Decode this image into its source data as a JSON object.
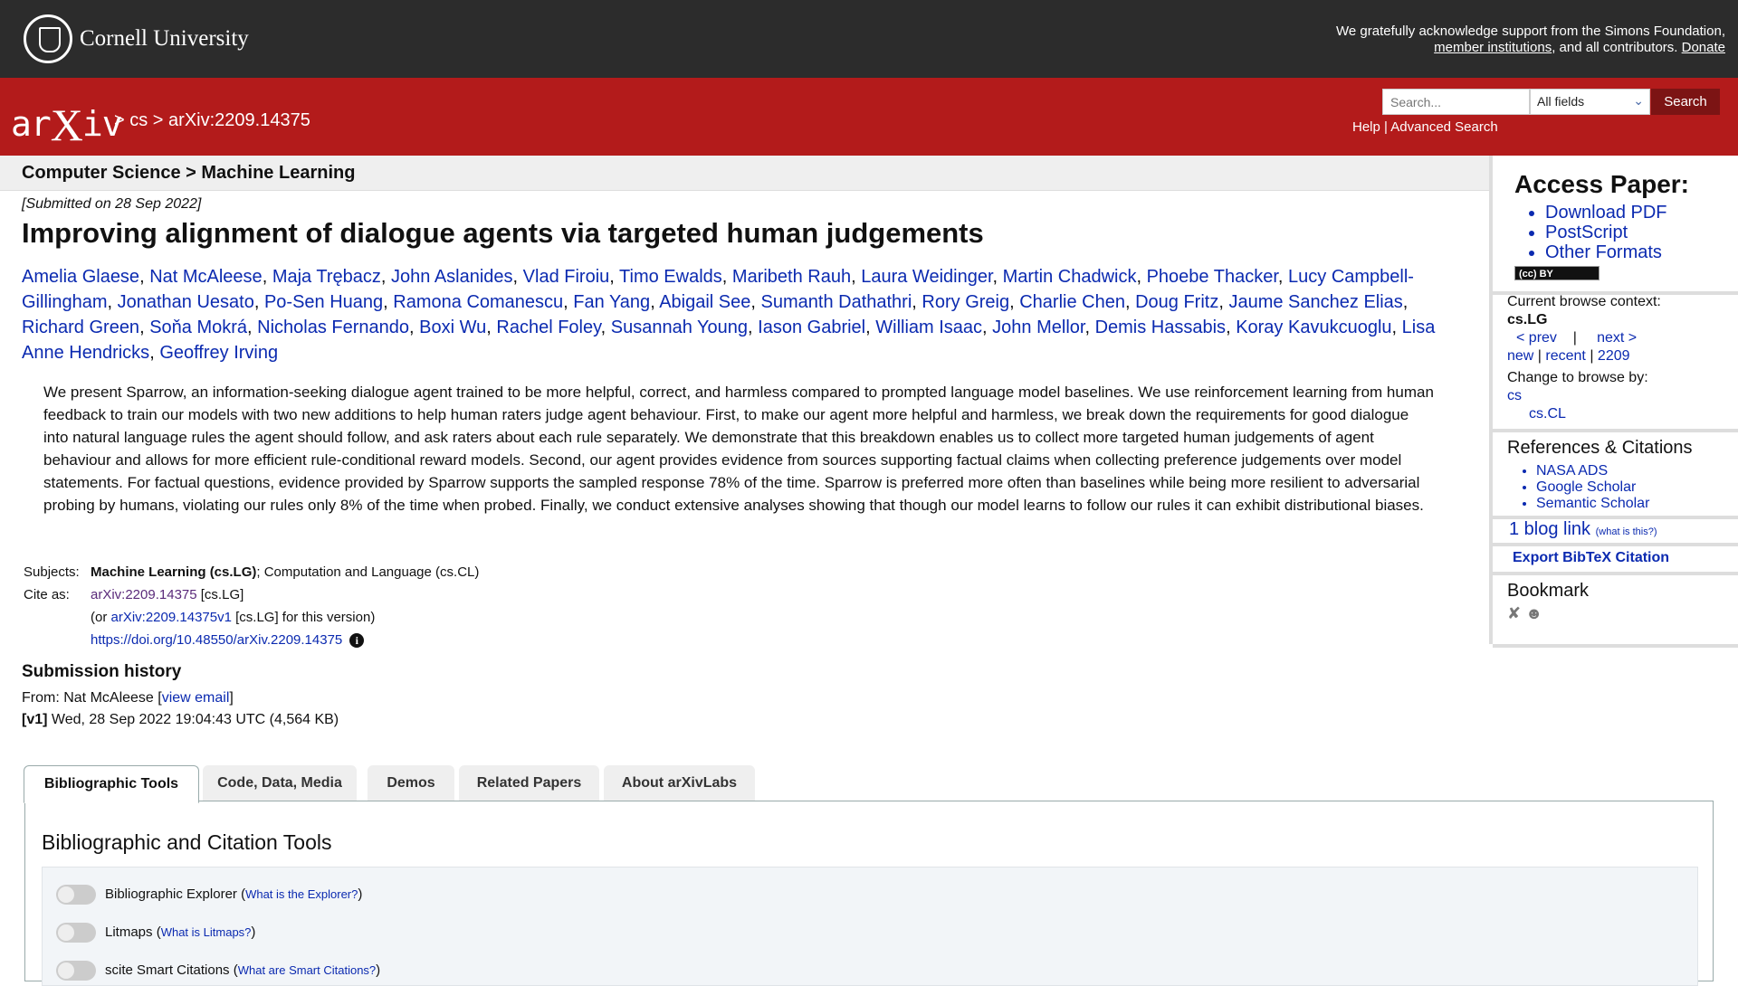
{
  "topbar": {
    "university": "Cornell University",
    "support_line1": "We gratefully acknowledge support from the Simons Foundation,",
    "member_institutions": "member institutions",
    "support_mid": ", and all contributors.",
    "donate": "Donate"
  },
  "header": {
    "logo_left": "ar",
    "logo_x": "X",
    "logo_right": "iv",
    "breadcrumb": "> cs > arXiv:2209.14375",
    "search_placeholder": "Search...",
    "field_selected": "All fields",
    "search_button": "Search",
    "help": "Help",
    "separator": "|",
    "advanced_search": "Advanced Search"
  },
  "subject_heading": "Computer Science > Machine Learning",
  "paper": {
    "submitted": "[Submitted on 28 Sep 2022]",
    "title": "Improving alignment of dialogue agents via targeted human judgements",
    "authors": [
      "Amelia Glaese",
      "Nat McAleese",
      "Maja Trębacz",
      "John Aslanides",
      "Vlad Firoiu",
      "Timo Ewalds",
      "Maribeth Rauh",
      "Laura Weidinger",
      "Martin Chadwick",
      "Phoebe Thacker",
      "Lucy Campbell-Gillingham",
      "Jonathan Uesato",
      "Po-Sen Huang",
      "Ramona Comanescu",
      "Fan Yang",
      "Abigail See",
      "Sumanth Dathathri",
      "Rory Greig",
      "Charlie Chen",
      "Doug Fritz",
      "Jaume Sanchez Elias",
      "Richard Green",
      "Soňa Mokrá",
      "Nicholas Fernando",
      "Boxi Wu",
      "Rachel Foley",
      "Susannah Young",
      "Iason Gabriel",
      "William Isaac",
      "John Mellor",
      "Demis Hassabis",
      "Koray Kavukcuoglu",
      "Lisa Anne Hendricks",
      "Geoffrey Irving"
    ],
    "abstract": "We present Sparrow, an information-seeking dialogue agent trained to be more helpful, correct, and harmless compared to prompted language model baselines. We use reinforcement learning from human feedback to train our models with two new additions to help human raters judge agent behaviour. First, to make our agent more helpful and harmless, we break down the requirements for good dialogue into natural language rules the agent should follow, and ask raters about each rule separately. We demonstrate that this breakdown enables us to collect more targeted human judgements of agent behaviour and allows for more efficient rule-conditional reward models. Second, our agent provides evidence from sources supporting factual claims when collecting preference judgements over model statements. For factual questions, evidence provided by Sparrow supports the sampled response 78% of the time. Sparrow is preferred more often than baselines while being more resilient to adversarial probing by humans, violating our rules only 8% of the time when probed. Finally, we conduct extensive analyses showing that though our model learns to follow our rules it can exhibit distributional biases.",
    "subjects_label": "Subjects:",
    "subjects_primary": "Machine Learning (cs.LG)",
    "subjects_rest": "; Computation and Language (cs.CL)",
    "cite_label": "Cite as:",
    "cite_id": "arXiv:2209.14375",
    "cite_tag": " [cs.LG]",
    "cite_or": "(or ",
    "cite_version": "arXiv:2209.14375v1",
    "cite_version_tail": " [cs.LG] for this version)",
    "doi": "https://doi.org/10.48550/arXiv.2209.14375",
    "info_glyph": "i"
  },
  "history": {
    "heading": "Submission history",
    "from_prefix": "From: Nat McAleese [",
    "view_email": "view email",
    "from_suffix": "]",
    "version": "[v1]",
    "version_detail": " Wed, 28 Sep 2022 19:04:43 UTC (4,564 KB)"
  },
  "tabs": [
    "Bibliographic Tools",
    "Code, Data, Media",
    "Demos",
    "Related Papers",
    "About arXivLabs"
  ],
  "tools": {
    "panel_title": "Bibliographic and Citation Tools",
    "items": [
      {
        "label": "Bibliographic Explorer",
        "link": "What is the Explorer?"
      },
      {
        "label": "Litmaps",
        "link": "What is Litmaps?"
      },
      {
        "label": "scite Smart Citations",
        "link": "What are Smart Citations?"
      }
    ]
  },
  "sidebar": {
    "access_heading": "Access Paper:",
    "access_links": [
      "Download PDF",
      "PostScript",
      "Other Formats"
    ],
    "license_badge": "(cc) BY",
    "browse_context_label": "Current browse context:",
    "browse_context": "cs.LG",
    "prev": "< prev",
    "next": "next >",
    "new": "new",
    "recent": "recent",
    "yearmonth": "2209",
    "change_browse": "Change to browse by:",
    "browse_cs": "cs",
    "browse_cscl": "cs.CL",
    "refs_heading": "References & Citations",
    "refs": [
      "NASA ADS",
      "Google Scholar",
      "Semantic Scholar"
    ],
    "blog_link": "1 blog link",
    "blog_what": "(what is this?)",
    "bibtex": "Export BibTeX Citation",
    "bookmark_heading": "Bookmark",
    "bookmark_icons": [
      "bibsonomy-icon",
      "reddit-icon"
    ]
  }
}
